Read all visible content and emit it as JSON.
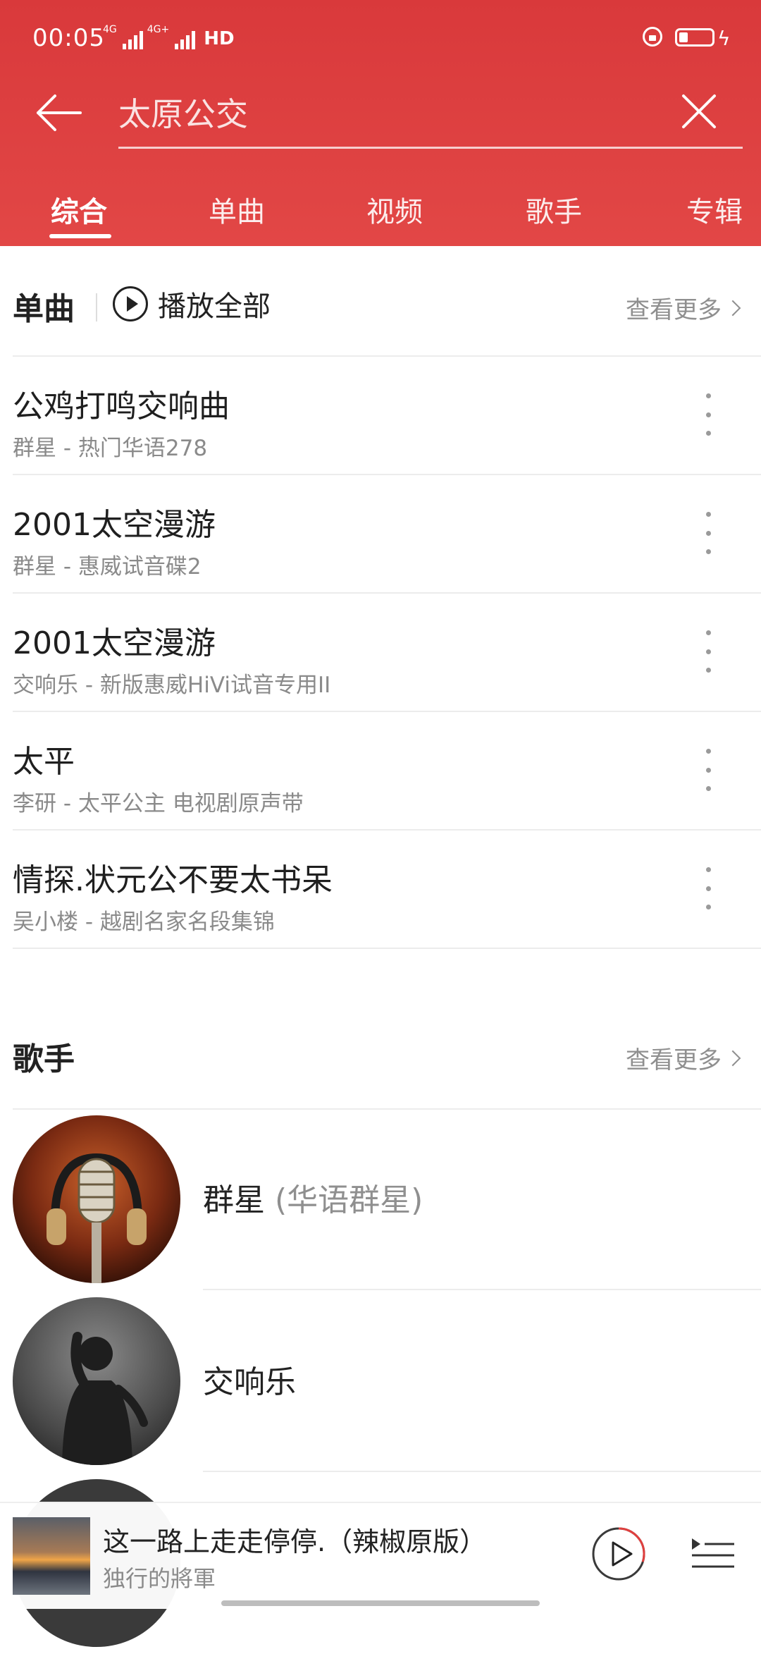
{
  "status_bar": {
    "time": "00:05",
    "network_1": "4G",
    "network_2": "4G+",
    "hd_label": "HD"
  },
  "search": {
    "query": "太原公交"
  },
  "tabs": [
    {
      "label": "综合",
      "active": true
    },
    {
      "label": "单曲",
      "active": false
    },
    {
      "label": "视频",
      "active": false
    },
    {
      "label": "歌手",
      "active": false
    },
    {
      "label": "专辑",
      "active": false
    }
  ],
  "songs_section": {
    "title": "单曲",
    "play_all": "播放全部",
    "more": "查看更多",
    "items": [
      {
        "title": "公鸡打鸣交响曲",
        "sub": "群星 - 热门华语278"
      },
      {
        "title": "2001太空漫游",
        "sub": "群星 - 惠威试音碟2"
      },
      {
        "title": "2001太空漫游",
        "sub": "交响乐 - 新版惠威HiVi试音专用II"
      },
      {
        "title": "太平",
        "sub": "李研 - 太平公主 电视剧原声带"
      },
      {
        "title": "情探.状元公不要太书呆",
        "sub": "吴小楼 - 越剧名家名段集锦"
      }
    ]
  },
  "artists_section": {
    "title": "歌手",
    "more": "查看更多",
    "items": [
      {
        "name": "群星",
        "alias": "(华语群星)"
      },
      {
        "name": "交响乐",
        "alias": ""
      }
    ]
  },
  "player": {
    "title": "这一路上走走停停.（辣椒原版）",
    "artist": "独行的將軍",
    "progress": 0.3,
    "accent": "#e0403f"
  }
}
